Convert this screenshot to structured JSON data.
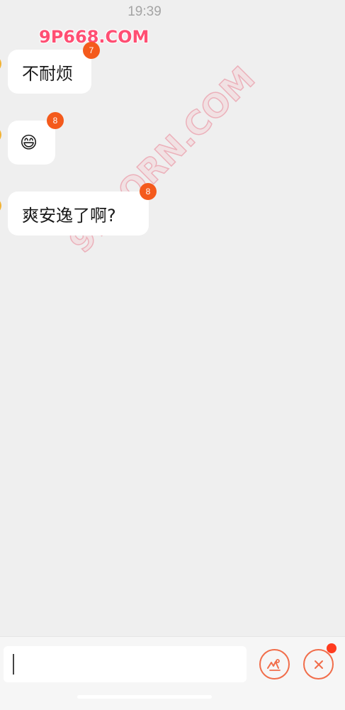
{
  "status_bar": {
    "time": "19:39"
  },
  "watermarks": {
    "top": "9P668.COM",
    "diagonal": "91PORN.COM"
  },
  "messages": [
    {
      "text": "不耐烦",
      "badge": "7"
    },
    {
      "text": "😄",
      "badge": "8"
    },
    {
      "text": "爽安逸了啊?",
      "badge": "8"
    }
  ],
  "input_bar": {
    "value": "",
    "pen_button_icon": "pen-icon",
    "close_button_icon": "close-icon"
  },
  "colors": {
    "background": "#efefef",
    "bubble": "#ffffff",
    "badge": "#f45a1c",
    "accent": "#f16d4a",
    "notification_dot": "#ff3b1f"
  }
}
